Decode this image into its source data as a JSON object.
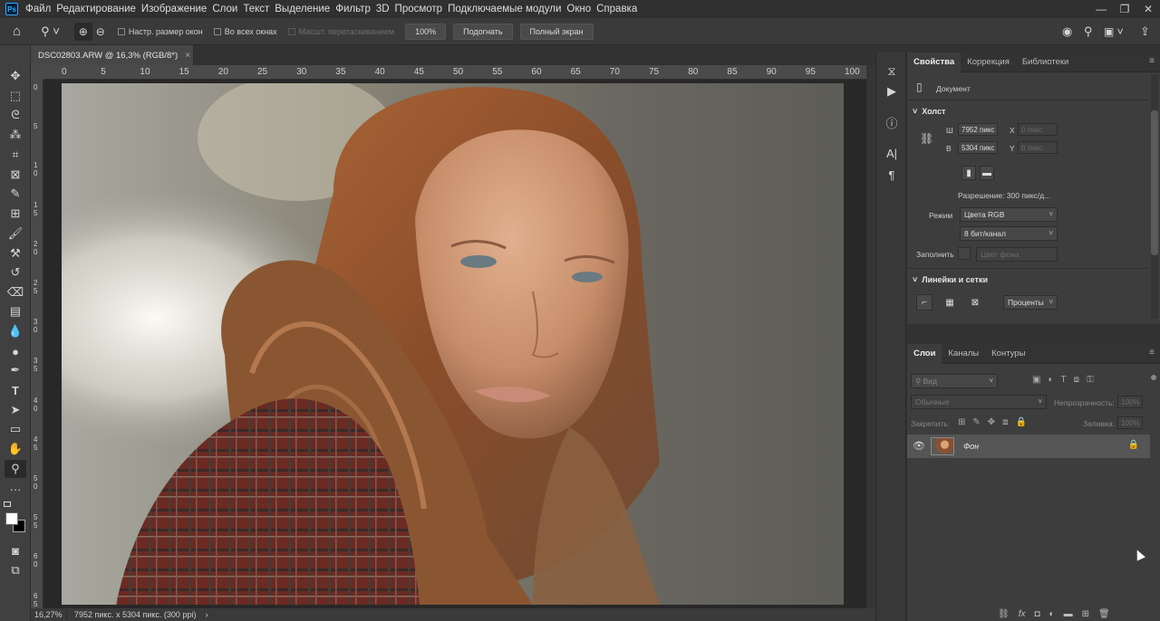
{
  "app": {
    "logo": "Ps"
  },
  "menu": [
    "Файл",
    "Редактирование",
    "Изображение",
    "Слои",
    "Текст",
    "Выделение",
    "Фильтр",
    "3D",
    "Просмотр",
    "Подключаемые модули",
    "Окно",
    "Справка"
  ],
  "options": {
    "resize_windows": "Настр. размер окон",
    "all_windows": "Во всех окнах",
    "scrubby_zoom": "Масшт. перетаскиванием",
    "zoom_100": "100%",
    "fit": "Подогнать",
    "fullscreen": "Полный экран"
  },
  "document": {
    "tab_title": "DSC02803.ARW @ 16,3% (RGB/8*)",
    "close": "×"
  },
  "ruler": {
    "h_ticks": [
      "0",
      "5",
      "10",
      "15",
      "20",
      "25",
      "30",
      "35",
      "40",
      "45",
      "50",
      "55",
      "60",
      "65",
      "70",
      "75",
      "80",
      "85",
      "90",
      "95",
      "100"
    ],
    "v_ticks": [
      "0",
      "5",
      "1\n0",
      "1\n5",
      "2\n0",
      "2\n5",
      "3\n0",
      "3\n5",
      "4\n0",
      "4\n5",
      "5\n0",
      "5\n5",
      "6\n0",
      "6\n5"
    ]
  },
  "status": {
    "zoom": "16,27%",
    "info": "7952 пикс. x 5304 пикс. (300 ppi)",
    "arrow": "›"
  },
  "properties": {
    "tabs": [
      "Свойства",
      "Коррекция",
      "Библиотеки"
    ],
    "doc_label": "Документ",
    "canvas_section": "Холст",
    "w_label": "Ш",
    "w_value": "7952 пикс",
    "h_label": "В",
    "h_value": "5304 пикс",
    "x_label": "X",
    "x_value": "0 пикс.",
    "y_label": "Y",
    "y_value": "0 пикс.",
    "resolution": "Разрешение: 300 пикс/д...",
    "mode_label": "Режим",
    "mode_value": "Цвета RGB",
    "depth_value": "8 бит/канал",
    "fill_label": "Заполнить",
    "fill_value": "Цвет фона",
    "rulers_section": "Линейки и сетки",
    "units_value": "Проценты"
  },
  "layers": {
    "tabs": [
      "Слои",
      "Каналы",
      "Контуры"
    ],
    "search_placeholder": "Вид",
    "blend_value": "Обычные",
    "opacity_label": "Непрозрачность:",
    "opacity_value": "100%",
    "lock_label": "Закрепить:",
    "fill_label": "Заливка:",
    "fill_value": "100%",
    "layer_name": "Фон"
  }
}
